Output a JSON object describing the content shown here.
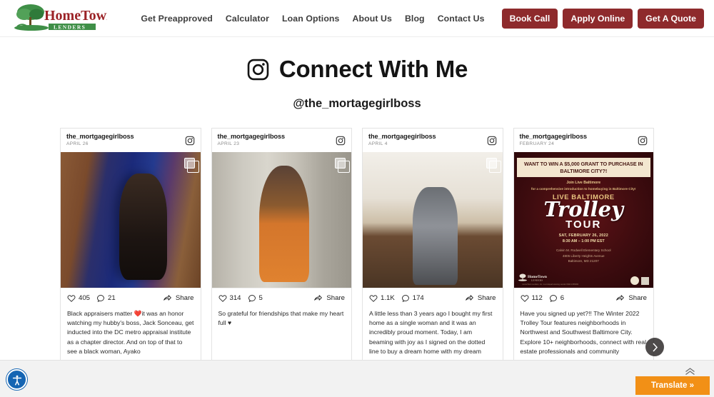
{
  "header": {
    "logo": {
      "name_main": "HomeTown",
      "name_sub": "LENDERS"
    },
    "nav_links": [
      {
        "label": "Get Preapproved"
      },
      {
        "label": "Calculator"
      },
      {
        "label": "Loan Options"
      },
      {
        "label": "About Us"
      },
      {
        "label": "Blog"
      },
      {
        "label": "Contact Us"
      }
    ],
    "nav_buttons": [
      {
        "label": "Book Call"
      },
      {
        "label": "Apply Online"
      },
      {
        "label": "Get A Quote"
      }
    ],
    "button_color": "#8e2a2c"
  },
  "section": {
    "title": "Connect With Me",
    "title_icon": "instagram-icon",
    "handle": "@the_mortagegirlboss"
  },
  "feed": {
    "carousel_next_icon": "chevron-right-icon",
    "posts": [
      {
        "username": "the_mortgagegirlboss",
        "date": "APRIL 26",
        "likes": "405",
        "comments": "21",
        "share_label": "Share",
        "caption": "Black appraisers matter ❤️it was an honor watching my hubby's boss, Jack Sonceau, get inducted into the DC metro appraisal institute as a chapter director. And on top of that to see a black woman, Ayako"
      },
      {
        "username": "the_mortgagegirlboss",
        "date": "APRIL 23",
        "likes": "314",
        "comments": "5",
        "share_label": "Share",
        "caption": "So grateful for friendships that make my heart full ♥"
      },
      {
        "username": "the_mortgagegirlboss",
        "date": "APRIL 4",
        "likes": "1.1K",
        "comments": "174",
        "share_label": "Share",
        "caption": "A little less than 3 years ago I bought my first home as a single woman and it was an incredibly proud moment. Today, I am beaming with joy as I signed on the dotted line to buy a dream home with my dream"
      },
      {
        "username": "the_mortgagegirlboss",
        "date": "FEBRUARY 24",
        "likes": "112",
        "comments": "6",
        "share_label": "Share",
        "caption": "Have you signed up yet?!! The Winter 2022 Trolley Tour features neighborhoods in Northwest and Southwest Baltimore City. Explore 10+ neighborhoods, connect with real estate professionals and community"
      }
    ],
    "flyer": {
      "banner": "WANT TO WIN A $5,000 GRANT TO PURCHASE IN BALTIMORE CITY?!",
      "sub1": "Join Live Baltimore",
      "sub2": "for a comprehensive introduction to homebuying in Baltimore City!",
      "live": "LIVE BALTIMORE",
      "script": "Trolley",
      "tour": "TOUR",
      "date": "SAT, FEBRUARY 26, 2022",
      "time": "8:30 AM – 1:00 PM EST",
      "venue": "Calvin M. Rodwell Elementary School",
      "address1": "4805 Liberty Heights Avenue",
      "address2": "Baltimore, MD 21207",
      "logo_main": "HomeTown",
      "logo_sub": "LENDERS",
      "disclaimer": "HomeTown Lenders, Inc. is an Equal Housing Lender NMLS #65084"
    }
  },
  "bottom": {
    "accessibility_icon": "accessibility-icon",
    "translate_label": "Translate »",
    "translate_color": "#f29016",
    "scroll_top_icon": "chevron-up-icon"
  }
}
